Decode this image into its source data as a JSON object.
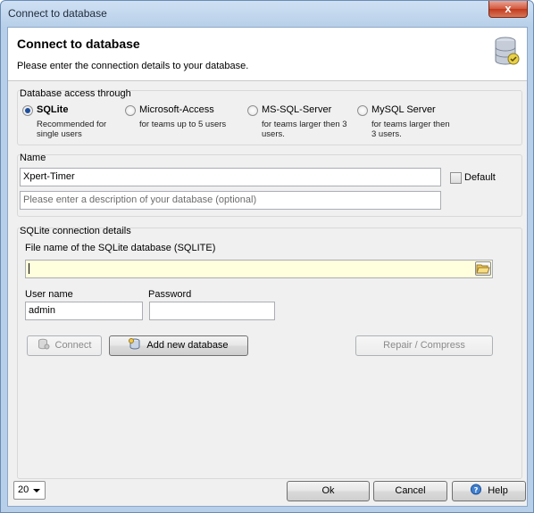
{
  "window": {
    "title": "Connect to database",
    "close_glyph": "x"
  },
  "header": {
    "title": "Connect to database",
    "subtitle": "Please enter the connection details to your database.",
    "icon": "database-icon"
  },
  "access": {
    "label": "Database access through",
    "options": [
      {
        "label": "SQLite",
        "desc": "Recommended for single users",
        "checked": true
      },
      {
        "label": "Microsoft-Access",
        "desc": "for teams up to 5 users",
        "checked": false
      },
      {
        "label": "MS-SQL-Server",
        "desc": "for teams larger then 3 users.",
        "checked": false
      },
      {
        "label": "MySQL Server",
        "desc": "for teams larger then 3 users.",
        "checked": false
      }
    ]
  },
  "name_section": {
    "label": "Name",
    "name_value": "Xpert-Timer",
    "description_placeholder": "Please enter a description of your database (optional)",
    "default_label": "Default"
  },
  "sqlite": {
    "label": "SQLite connection details",
    "file_label": "File name of the SQLite database (SQLITE)",
    "file_value": "",
    "username_label": "User name",
    "username_value": "admin",
    "password_label": "Password",
    "password_value": ""
  },
  "actions": {
    "connect": "Connect",
    "add_new": "Add new database",
    "repair": "Repair / Compress"
  },
  "footer": {
    "combo_value": "20",
    "ok": "Ok",
    "cancel": "Cancel",
    "help": "Help"
  }
}
